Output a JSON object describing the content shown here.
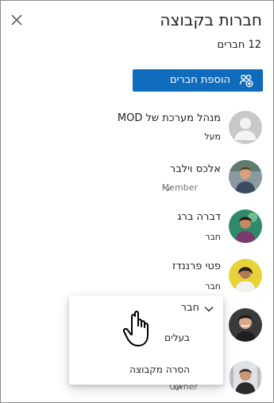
{
  "header": {
    "title": "חברות בקבוצה",
    "member_count": "12 חברים",
    "close_icon": "close-icon"
  },
  "actions": {
    "add_members_label": "הוספת חברים",
    "add_members_icon": "add-people-icon",
    "accent_color": "#0f6cbd"
  },
  "members": [
    {
      "name": "מנהל מערכת של MOD",
      "role": "מעל",
      "role_dropdown": false
    },
    {
      "name": "אלכס וילבר",
      "role": "Member",
      "role_dropdown": true
    },
    {
      "name": "דברה ברג",
      "role": "חבר",
      "role_dropdown": false
    },
    {
      "name": "פטי פרננדז",
      "role": "חבר",
      "role_dropdown": false
    },
    {
      "name": "",
      "role": "",
      "role_dropdown": false
    },
    {
      "name": "",
      "role": "Owner",
      "role_dropdown": true
    }
  ],
  "role_menu": {
    "selected": "חבר",
    "options": [
      "בעלים",
      "הסרה מקבוצה"
    ]
  }
}
